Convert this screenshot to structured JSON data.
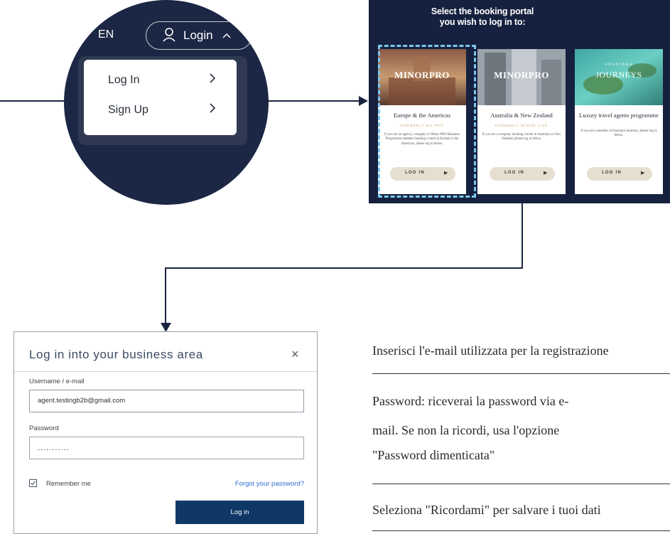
{
  "zoom": {
    "lang": "EN",
    "login_label": "Login",
    "menu": [
      {
        "label": "Log In"
      },
      {
        "label": "Sign Up"
      }
    ]
  },
  "portal": {
    "title_line1": "Select the booking portal",
    "title_line2": "you wish to log in to:",
    "cards": [
      {
        "brand": "MINORPRO",
        "title": "Europe & the Americas",
        "subtitle": "FORMERLY NH PRO",
        "description": "If you are an agency, company or Minor PRO Business Programme member booking a hotel in Europe or the Americas, please log in below.",
        "button": "LOG IN"
      },
      {
        "brand": "MINORPRO",
        "title": "Australia & New Zealand",
        "subtitle": "FORMERLY MINOR LIVE",
        "description": "If you are a company booking a hotel in Australia or New Zealand, please log in below.",
        "button": "LOG IN"
      },
      {
        "brand_top": "ANANTARA",
        "brand": "JOURNEYS",
        "title": "Luxury travel agents programme",
        "subtitle": "",
        "description": "If you are a member of Anantara Journeys, please log in below.",
        "button": "LOG IN"
      }
    ]
  },
  "login_form": {
    "title": "Log in into your business area",
    "close": "×",
    "username_label": "Username / e-mail",
    "username_value": "agent.testingb2b@gmail.com",
    "password_label": "Password",
    "password_value": "...........",
    "remember_label": "Remember me",
    "forgot_label": "Forgot your password?",
    "submit_label": "Log in"
  },
  "instructions": {
    "step1": "Inserisci l'e-mail utilizzata per la registrazione",
    "step2_line1": "Password: riceverai la password via e-",
    "step2_line2": "mail. Se non la ricordi, usa l'opzione",
    "step2_line3": "\"Password dimenticata\"",
    "step3": "Seleziona \"Ricordami\" per salvare i tuoi dati"
  },
  "colors": {
    "navy": "#16213f",
    "button_navy": "#0f3866",
    "link_blue": "#2f6fd0",
    "gold": "#c9a56a",
    "highlight": "#7cc7f0"
  }
}
